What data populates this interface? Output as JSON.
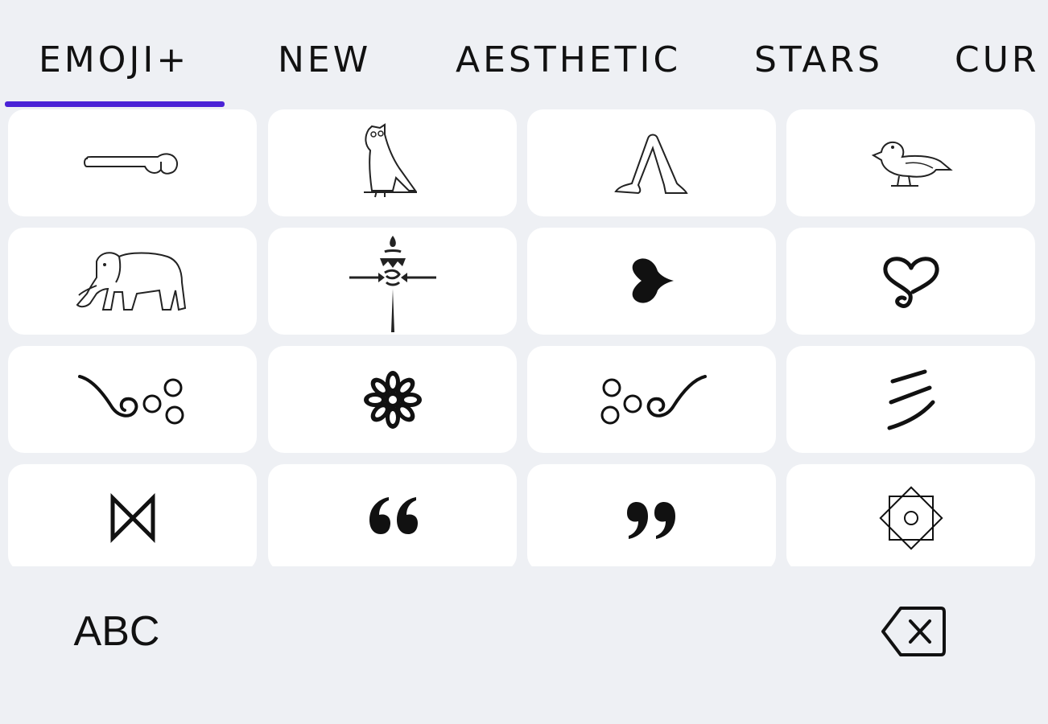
{
  "tabs": [
    {
      "label": "EMOJI+",
      "selected": true
    },
    {
      "label": "NEW",
      "selected": false
    },
    {
      "label": "AESTHETIC",
      "selected": false
    },
    {
      "label": "STARS",
      "selected": false
    },
    {
      "label": "CUR",
      "selected": false
    }
  ],
  "accent_color": "#4a22d6",
  "symbols": [
    [
      "phallus-hieroglyph-icon",
      "owl-hieroglyph-icon",
      "walking-legs-hieroglyph-icon",
      "duck-hieroglyph-icon"
    ],
    [
      "elephant-hieroglyph-icon",
      "tibetan-ornament-icon",
      "black-heart-bullet-icon",
      "swirl-heart-icon"
    ],
    [
      "cloud-swirl-left-icon",
      "flower-rosette-icon",
      "cloud-swirl-right-icon",
      "triple-stroke-icon"
    ],
    [
      "bowtie-icon",
      "left-double-quote-icon",
      "right-double-quote-icon",
      "octagram-circle-icon"
    ]
  ],
  "bottom_bar": {
    "abc_label": "ABC",
    "backspace_icon": "backspace-icon"
  }
}
